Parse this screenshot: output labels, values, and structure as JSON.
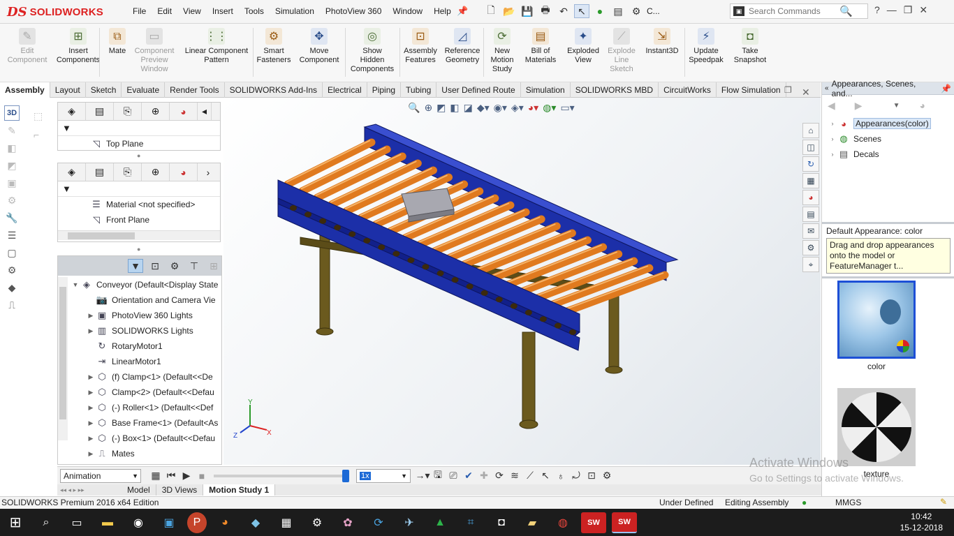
{
  "app": {
    "brand": "SOLIDWORKS",
    "menus": [
      "File",
      "Edit",
      "View",
      "Insert",
      "Tools",
      "Simulation",
      "PhotoView 360",
      "Window",
      "Help"
    ],
    "search_placeholder": "Search Commands",
    "quick_label": "C..."
  },
  "commands": [
    {
      "label": "Edit\nComponent",
      "icon": "edit-component-icon",
      "enabled": false
    },
    {
      "label": "Insert\nComponents",
      "icon": "insert-components-icon",
      "enabled": true
    },
    {
      "label": "Mate",
      "icon": "mate-icon",
      "enabled": true
    },
    {
      "label": "Component\nPreview\nWindow",
      "icon": "component-preview-icon",
      "enabled": false
    },
    {
      "label": "Linear Component\nPattern",
      "icon": "linear-pattern-icon",
      "enabled": true
    },
    {
      "label": "Smart\nFasteners",
      "icon": "smart-fasteners-icon",
      "enabled": true
    },
    {
      "label": "Move\nComponent",
      "icon": "move-component-icon",
      "enabled": true
    },
    {
      "label": "Show\nHidden\nComponents",
      "icon": "show-hidden-icon",
      "enabled": true
    },
    {
      "label": "Assembly\nFeatures",
      "icon": "assembly-features-icon",
      "enabled": true
    },
    {
      "label": "Reference\nGeometry",
      "icon": "reference-geometry-icon",
      "enabled": true
    },
    {
      "label": "New\nMotion\nStudy",
      "icon": "motion-study-icon",
      "enabled": true
    },
    {
      "label": "Bill of\nMaterials",
      "icon": "bom-icon",
      "enabled": true
    },
    {
      "label": "Exploded\nView",
      "icon": "exploded-view-icon",
      "enabled": true
    },
    {
      "label": "Explode\nLine\nSketch",
      "icon": "explode-line-icon",
      "enabled": false
    },
    {
      "label": "Instant3D",
      "icon": "instant3d-icon",
      "enabled": true
    },
    {
      "label": "Update\nSpeedpak",
      "icon": "speedpak-icon",
      "enabled": true
    },
    {
      "label": "Take\nSnapshot",
      "icon": "snapshot-icon",
      "enabled": true
    }
  ],
  "tabs": [
    "Assembly",
    "Layout",
    "Sketch",
    "Evaluate",
    "Render Tools",
    "SOLIDWORKS Add-Ins",
    "Electrical",
    "Piping",
    "Tubing",
    "User Defined Route",
    "Simulation",
    "SOLIDWORKS MBD",
    "CircuitWorks",
    "Flow Simulation"
  ],
  "active_tab": "Assembly",
  "fm_panel1": {
    "item": "Top Plane"
  },
  "fm_panel2": {
    "items": [
      "Material <not specified>",
      "Front Plane"
    ]
  },
  "tree": {
    "root": "Conveyor  (Default<Display State",
    "items": [
      {
        "label": "Orientation and Camera Vie",
        "expand": false,
        "icon": "camera-icon"
      },
      {
        "label": "PhotoView 360 Lights",
        "expand": true,
        "icon": "photoview-lights-icon"
      },
      {
        "label": "SOLIDWORKS Lights",
        "expand": true,
        "icon": "lights-icon"
      },
      {
        "label": "RotaryMotor1",
        "expand": false,
        "icon": "rotary-motor-icon"
      },
      {
        "label": "LinearMotor1",
        "expand": false,
        "icon": "linear-motor-icon"
      },
      {
        "label": "(f) Clamp<1> (Default<<De",
        "expand": true,
        "icon": "part-icon"
      },
      {
        "label": "Clamp<2> (Default<<Defau",
        "expand": true,
        "icon": "part-icon"
      },
      {
        "label": "(-) Roller<1> (Default<<Def",
        "expand": true,
        "icon": "part-icon"
      },
      {
        "label": "Base Frame<1> (Default<As",
        "expand": true,
        "icon": "part-icon"
      },
      {
        "label": "(-) Box<1> (Default<<Defau",
        "expand": true,
        "icon": "part-icon"
      },
      {
        "label": "Mates",
        "expand": true,
        "icon": "mates-icon"
      }
    ]
  },
  "right_panel": {
    "title": "Appearances, Scenes, and...",
    "tree": [
      "Appearances(color)",
      "Scenes",
      "Decals"
    ],
    "default_title": "Default Appearance: color",
    "tooltip": "Drag and drop appearances onto the model or FeatureManager t...",
    "swatches": [
      "color",
      "texture"
    ]
  },
  "motion": {
    "study_type": "Animation",
    "speed": "1x",
    "tabs": [
      "Model",
      "3D Views",
      "Motion Study 1"
    ],
    "active_tab": "Motion Study 1"
  },
  "status": {
    "edition": "SOLIDWORKS Premium 2016 x64 Edition",
    "state": "Under Defined",
    "mode": "Editing Assembly",
    "units": "MMGS"
  },
  "watermark": {
    "line1": "Activate Windows",
    "line2": "Go to Settings to activate Windows."
  },
  "clock": {
    "time": "10:42",
    "date": "15-12-2018"
  },
  "triad": {
    "x": "X",
    "y": "Y",
    "z": "Z"
  },
  "colors": {
    "roller": "#e07a1f",
    "rail": "#1c2fa8",
    "leg": "#6b5a1e",
    "box": "#a8a8b0",
    "accent_red": "#d22222"
  }
}
